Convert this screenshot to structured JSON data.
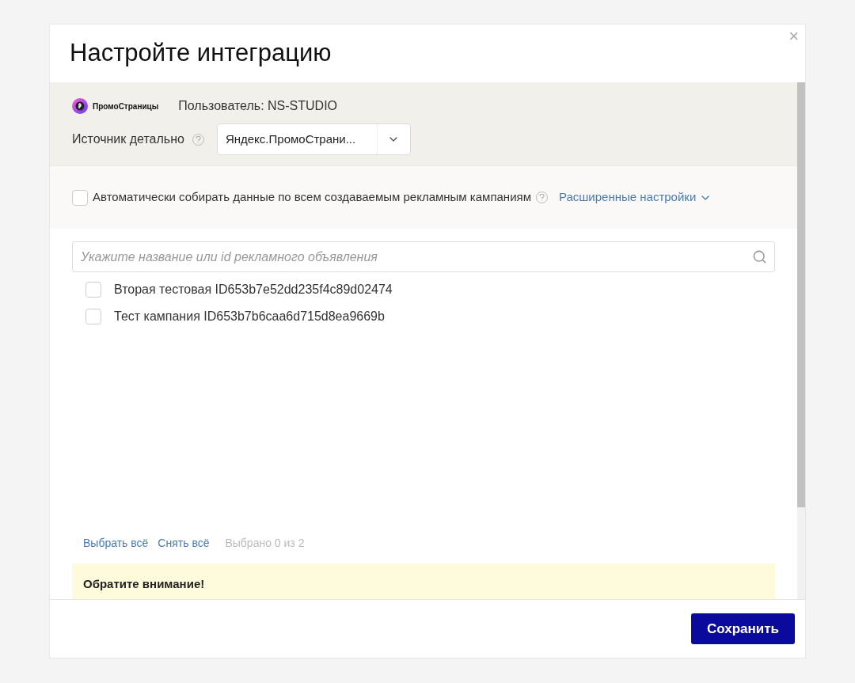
{
  "dialog": {
    "title": "Настройте интеграцию",
    "close": "×"
  },
  "source": {
    "logo_text": "ПромоСтраницы",
    "user": "Пользователь: NS-STUDIO",
    "detail_label": "Источник детально",
    "detail_value": "Яндекс.ПромоСтрани..."
  },
  "auto_collect": {
    "label": "Автоматически собирать данные по всем создаваемым рекламным кампаниям",
    "checked": false,
    "advanced_link": "Расширенные настройки"
  },
  "search": {
    "placeholder": "Укажите название или id рекламного объявления"
  },
  "campaigns": [
    {
      "label": "Вторая тестовая ID653b7e52dd235f4c89d02474",
      "checked": false
    },
    {
      "label": "Тест кампания ID653b7b6caa6d715d8ea9669b",
      "checked": false
    }
  ],
  "selection": {
    "select_all": "Выбрать всё",
    "clear_all": "Снять всё",
    "count": "Выбрано 0 из 2"
  },
  "notice": {
    "title": "Обратите внимание!"
  },
  "buttons": {
    "save": "Сохранить"
  }
}
